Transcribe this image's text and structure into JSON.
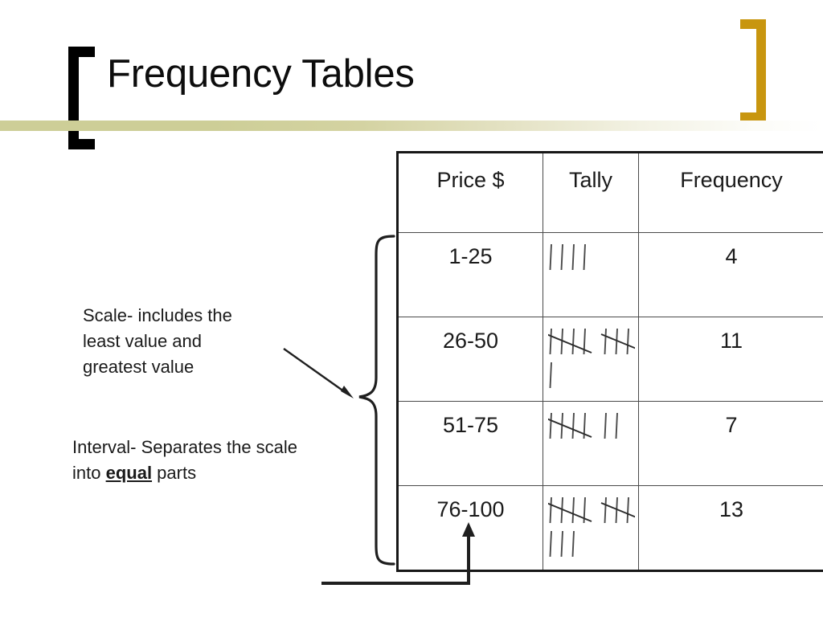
{
  "slide": {
    "title": "Frequency Tables",
    "accent_gold": "#c8960f",
    "band_color": "#cdce97",
    "bracket_color": "#000000"
  },
  "annotations": {
    "scale": {
      "text": "Scale- includes the least value and greatest value",
      "line1": "Scale- includes the",
      "line2": "least value and",
      "line3": "greatest value"
    },
    "interval": {
      "prefix": "Interval- Separates the scale into ",
      "emphasis": "equal",
      "suffix": " parts"
    }
  },
  "table": {
    "headers": [
      "Price $",
      "Tally",
      "Frequency"
    ],
    "rows": [
      {
        "price": "1-25",
        "tally_marks": 4,
        "frequency": "4"
      },
      {
        "price": "26-50",
        "tally_marks": 11,
        "frequency": "11"
      },
      {
        "price": "51-75",
        "tally_marks": 7,
        "frequency": "7"
      },
      {
        "price": "76-100",
        "tally_marks": 13,
        "frequency": "13"
      }
    ]
  },
  "chart_data": {
    "type": "table",
    "title": "Frequency Tables",
    "columns": [
      "Price $",
      "Tally",
      "Frequency"
    ],
    "categories": [
      "1-25",
      "26-50",
      "51-75",
      "76-100"
    ],
    "values": [
      4,
      11,
      7,
      13
    ],
    "xlabel": "Price $",
    "ylabel": "Frequency",
    "annotations": [
      "Scale- includes the least value and greatest value",
      "Interval- Separates the scale into equal parts"
    ]
  }
}
